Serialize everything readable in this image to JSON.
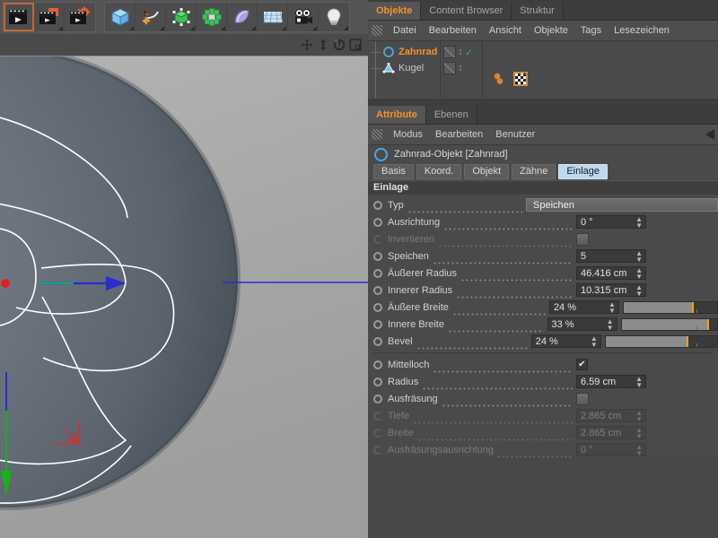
{
  "toolbar": {
    "groups": [
      {
        "name": "render-group",
        "buttons": [
          {
            "name": "render-view-button",
            "icon": "clapperboard-icon",
            "selected": true
          },
          {
            "name": "render-region-button",
            "icon": "clapperboard-region-icon",
            "selected": false
          },
          {
            "name": "render-settings-button",
            "icon": "clapperboard-gear-icon",
            "selected": false
          }
        ]
      },
      {
        "name": "objects-group",
        "buttons": [
          {
            "name": "primitive-cube-button",
            "icon": "cube-icon",
            "selected": false
          },
          {
            "name": "spline-pen-button",
            "icon": "spline-pen-icon",
            "selected": false
          },
          {
            "name": "generator-button",
            "icon": "generator-cube-icon",
            "selected": false
          },
          {
            "name": "deformer-button",
            "icon": "deformer-icon",
            "selected": false
          },
          {
            "name": "environment-button",
            "icon": "environment-icon",
            "selected": false
          },
          {
            "name": "floor-button",
            "icon": "floor-grid-icon",
            "selected": false
          },
          {
            "name": "camera-button",
            "icon": "camera-icon",
            "selected": false
          },
          {
            "name": "light-button",
            "icon": "light-bulb-icon",
            "selected": false
          }
        ]
      }
    ]
  },
  "viewport": {
    "nav_icons": [
      {
        "name": "move-view-icon",
        "glyph": "move-arrows"
      },
      {
        "name": "scale-view-icon",
        "glyph": "updown-arrows"
      },
      {
        "name": "rotate-view-icon",
        "glyph": "rotate"
      },
      {
        "name": "maximize-view-icon",
        "glyph": "panel"
      }
    ]
  },
  "object_manager": {
    "tabs": [
      {
        "label": "Objekte",
        "active": true
      },
      {
        "label": "Content Browser",
        "active": false
      },
      {
        "label": "Struktur",
        "active": false
      }
    ],
    "menu": [
      "Datei",
      "Bearbeiten",
      "Ansicht",
      "Objekte",
      "Tags",
      "Lesezeichen"
    ],
    "items": [
      {
        "label": "Zahnrad",
        "icon": "gear-object-icon",
        "selected": true,
        "enabled_check": "✓"
      },
      {
        "label": "Kugel",
        "icon": "sphere-object-icon",
        "selected": false,
        "enabled_check": ""
      }
    ]
  },
  "attribute_manager": {
    "tabs": [
      {
        "label": "Attribute",
        "active": true
      },
      {
        "label": "Ebenen",
        "active": false
      }
    ],
    "menu": [
      "Modus",
      "Bearbeiten",
      "Benutzer"
    ],
    "object_title": "Zahnrad-Objekt [Zahnrad]",
    "object_tabs": [
      {
        "label": "Basis",
        "active": false
      },
      {
        "label": "Koord.",
        "active": false
      },
      {
        "label": "Objekt",
        "active": false
      },
      {
        "label": "Zähne",
        "active": false
      },
      {
        "label": "Einlage",
        "active": true
      }
    ],
    "group_header": "Einlage",
    "rows": [
      {
        "label": "Typ",
        "type": "dropdown",
        "value": "Speichen",
        "disabled": false
      },
      {
        "label": "Ausrichtung",
        "type": "number",
        "value": "0 °",
        "disabled": false
      },
      {
        "label": "Invertieren",
        "type": "button",
        "value": "",
        "disabled": true
      },
      {
        "label": "Speichen",
        "type": "number",
        "value": "5",
        "disabled": false
      },
      {
        "label": "Äußerer Radius",
        "type": "number",
        "value": "46.416 cm",
        "disabled": false
      },
      {
        "label": "Innerer Radius",
        "type": "number",
        "value": "10.315 cm",
        "disabled": false
      },
      {
        "label": "Äußere Breite",
        "type": "slider",
        "value": "24 %",
        "percent": 24,
        "disabled": false
      },
      {
        "label": "Innere Breite",
        "type": "slider",
        "value": "33 %",
        "percent": 33,
        "disabled": false
      },
      {
        "label": "Bevel",
        "type": "slider",
        "value": "24 %",
        "percent": 24,
        "disabled": false
      },
      {
        "separator": true
      },
      {
        "label": "Mittelloch",
        "type": "checkbox",
        "value": "✔",
        "checked": true,
        "disabled": false
      },
      {
        "label": "Radius",
        "type": "number",
        "value": "6.59 cm",
        "disabled": false
      },
      {
        "label": "Ausfräsung",
        "type": "button",
        "value": "",
        "disabled": false
      },
      {
        "label": "Tiefe",
        "type": "number",
        "value": "2.865 cm",
        "disabled": true
      },
      {
        "label": "Breite",
        "type": "number",
        "value": "2.865 cm",
        "disabled": true
      },
      {
        "label": "Ausfräsungsausrichtung",
        "type": "number",
        "value": "0 °",
        "disabled": true
      }
    ]
  },
  "colors": {
    "accent_orange": "#f0932b",
    "tab_active": "#bed8f0",
    "slider_mark": "#f0a020",
    "object_outline": "#4aa8e0",
    "check_green": "#3fa86b"
  }
}
